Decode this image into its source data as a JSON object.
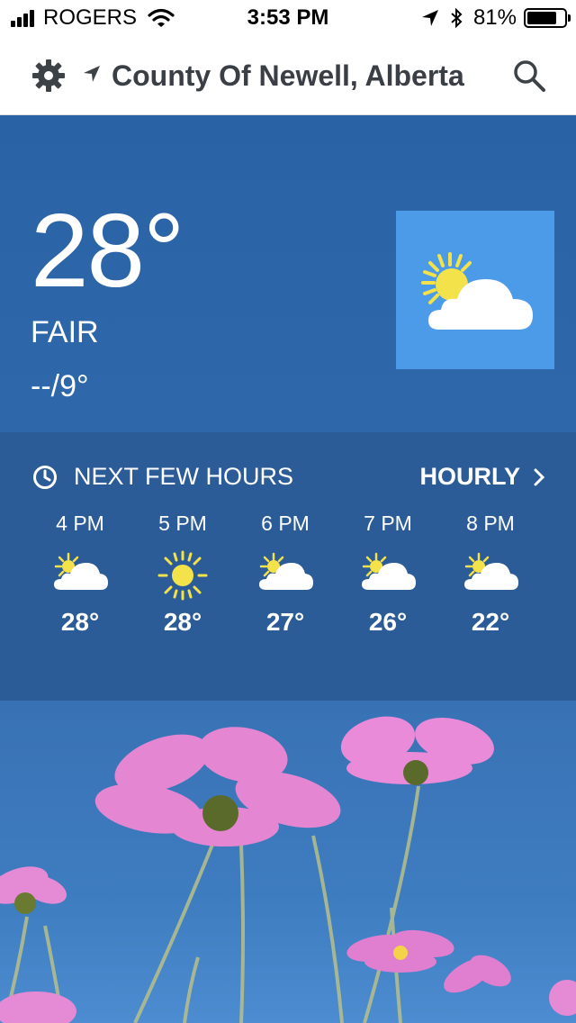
{
  "status_bar": {
    "carrier": "ROGERS",
    "time": "3:53 PM",
    "battery": "81%",
    "battery_level": 0.81
  },
  "header": {
    "location": "County Of Newell, Alberta"
  },
  "current": {
    "temperature": "28°",
    "condition": "FAIR",
    "hi_lo": "--/9°",
    "icon": "partly-sunny-icon"
  },
  "hourly": {
    "title": "NEXT FEW HOURS",
    "link_label": "HOURLY",
    "items": [
      {
        "time": "4 PM",
        "icon": "partly-sunny",
        "temp": "28°"
      },
      {
        "time": "5 PM",
        "icon": "sunny",
        "temp": "28°"
      },
      {
        "time": "6 PM",
        "icon": "partly-sunny",
        "temp": "27°"
      },
      {
        "time": "7 PM",
        "icon": "partly-sunny",
        "temp": "26°"
      },
      {
        "time": "8 PM",
        "icon": "partly-sunny",
        "temp": "22°"
      }
    ]
  },
  "colors": {
    "sky": "#2a62a6",
    "hourly_panel": "#2c5c98",
    "icon_tile": "#4c9be8",
    "sun": "#f4e24a",
    "flower": "#e07fd0"
  }
}
